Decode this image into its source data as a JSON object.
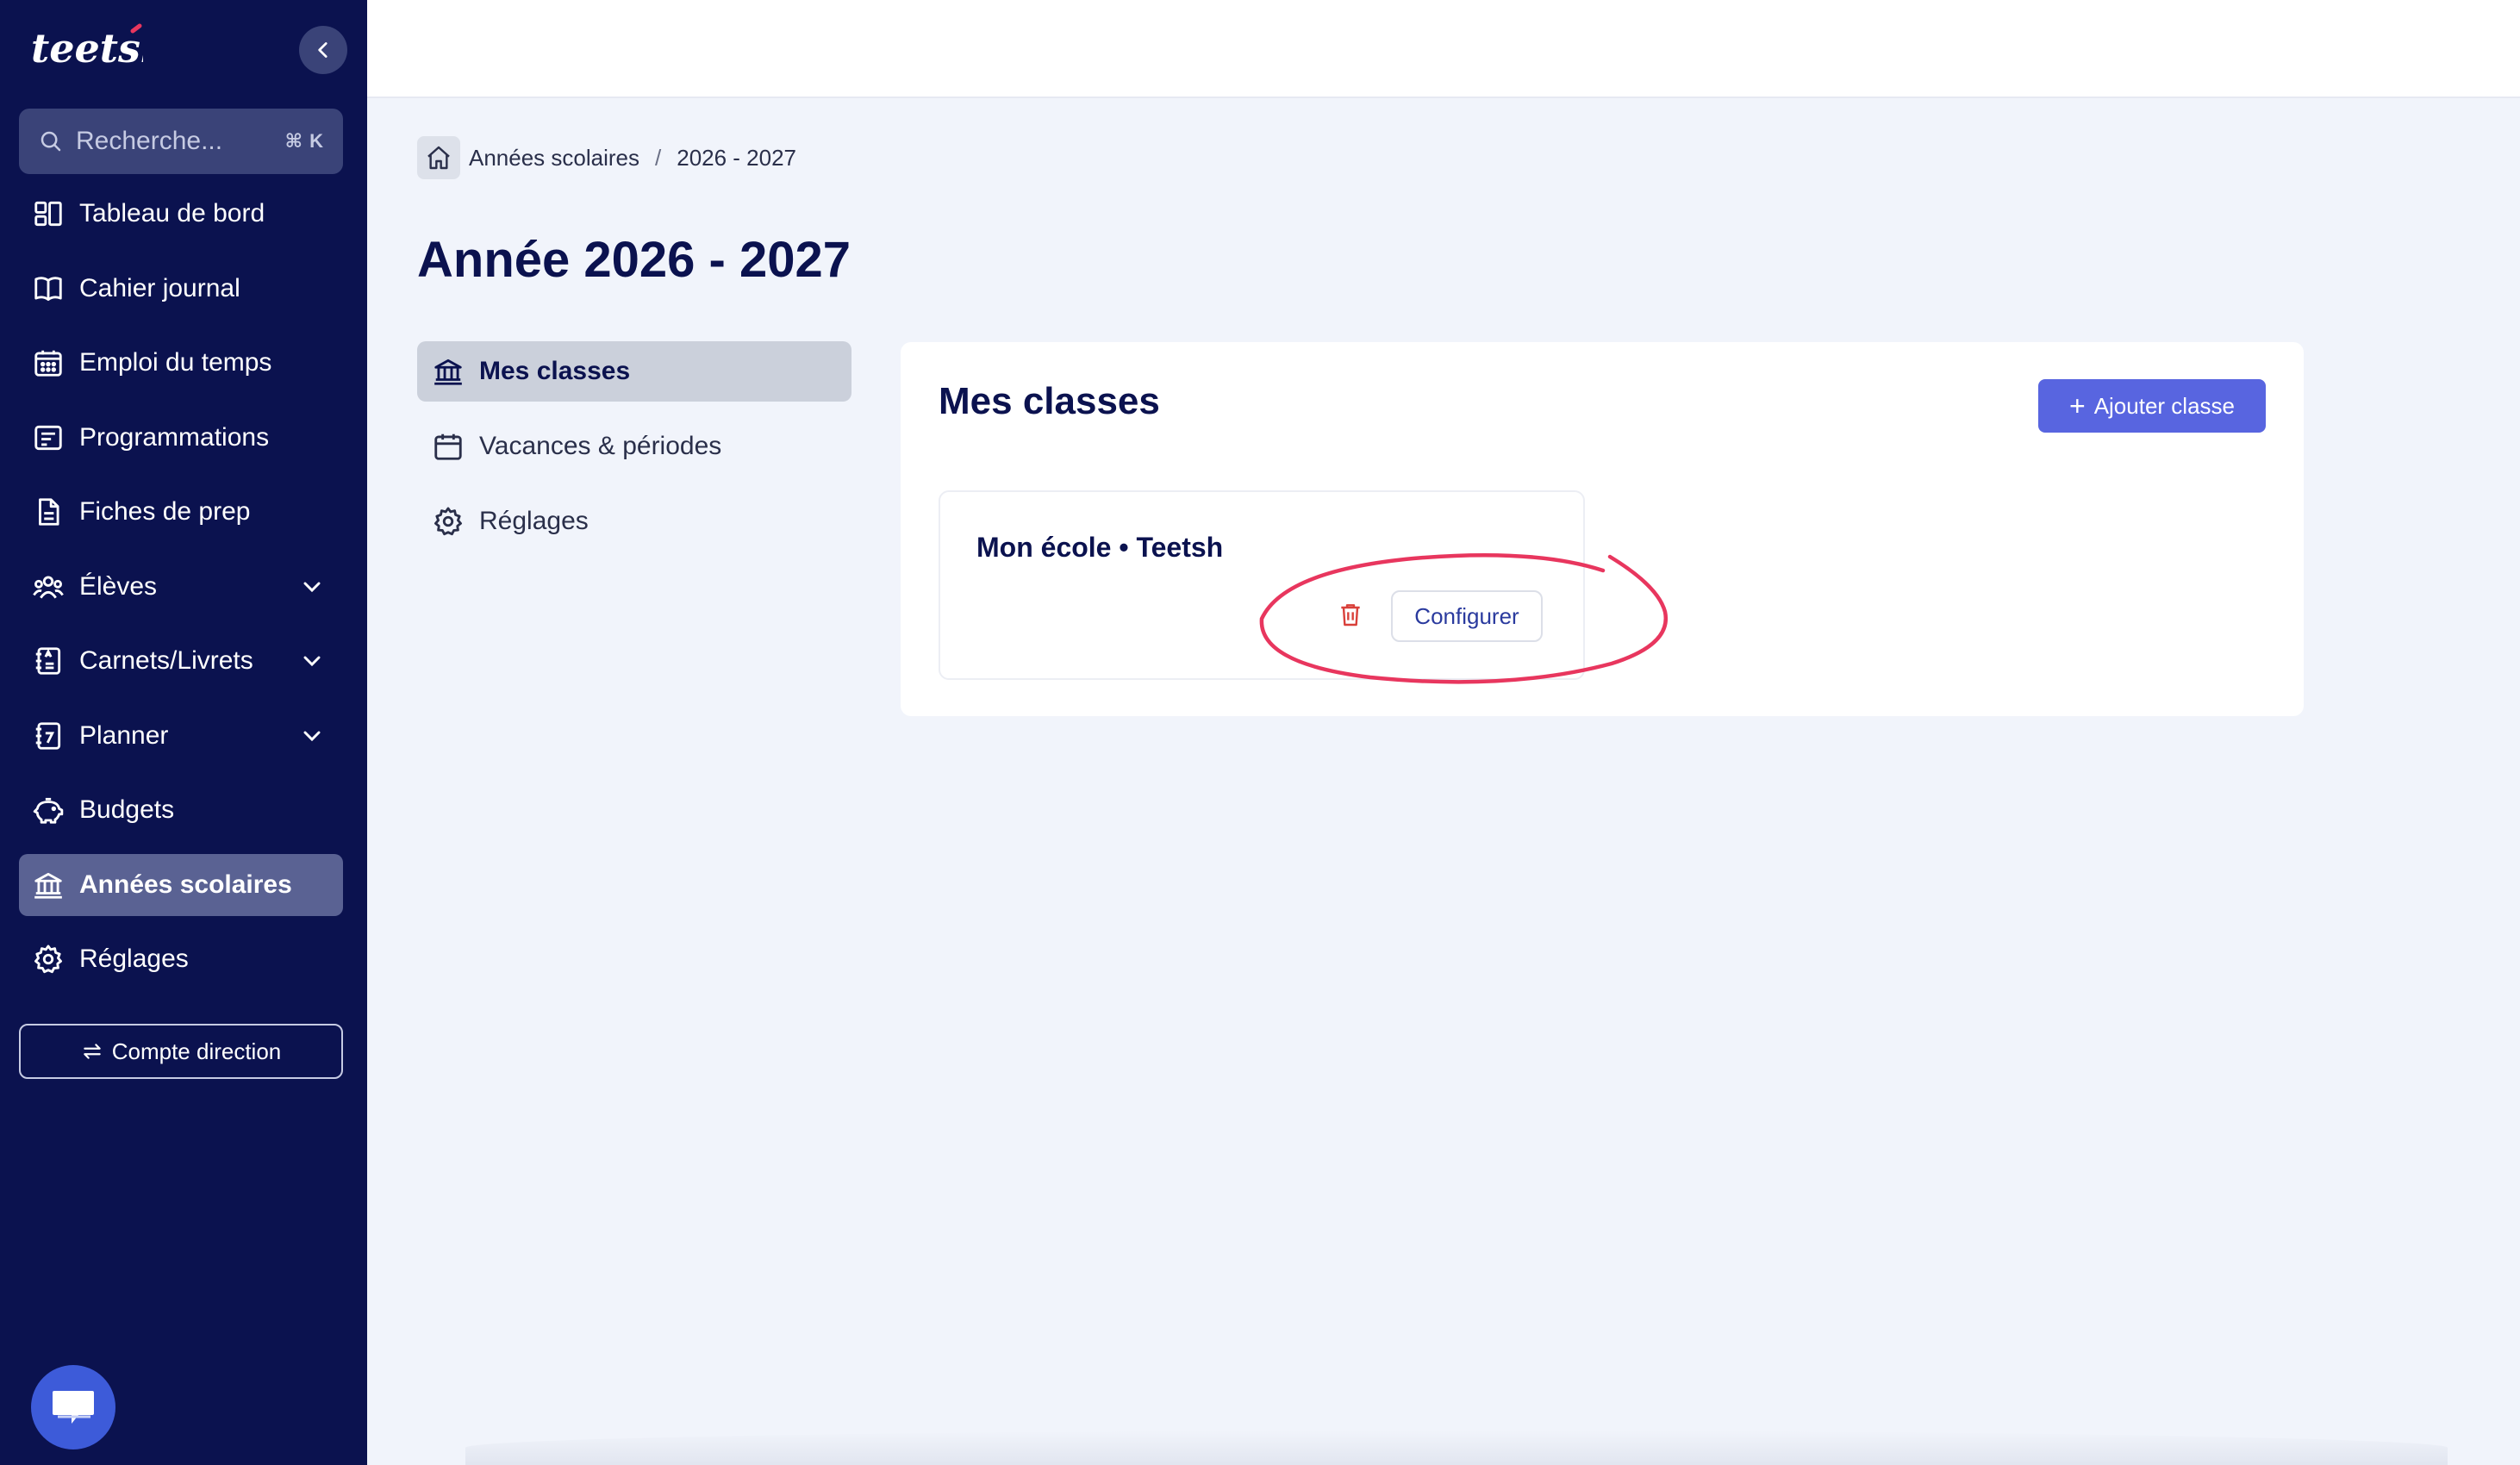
{
  "sidebar": {
    "logo_text": "teetsh",
    "search": {
      "placeholder": "Recherche...",
      "shortcut": "⌘ K"
    },
    "items": [
      {
        "label": "Tableau de bord",
        "icon": "dashboard-icon"
      },
      {
        "label": "Cahier journal",
        "icon": "book-icon"
      },
      {
        "label": "Emploi du temps",
        "icon": "calendar-grid-icon"
      },
      {
        "label": "Programmations",
        "icon": "list-board-icon"
      },
      {
        "label": "Fiches de prep",
        "icon": "document-icon"
      },
      {
        "label": "Élèves",
        "icon": "students-icon",
        "expandable": true
      },
      {
        "label": "Carnets/Livrets",
        "icon": "notebook-icon",
        "expandable": true
      },
      {
        "label": "Planner",
        "icon": "planner-icon",
        "expandable": true
      },
      {
        "label": "Budgets",
        "icon": "piggy-bank-icon"
      },
      {
        "label": "Années scolaires",
        "icon": "school-icon",
        "active": true
      },
      {
        "label": "Réglages",
        "icon": "gear-icon"
      }
    ],
    "compte_button": "Compte direction"
  },
  "breadcrumb": {
    "items": [
      "Années scolaires",
      "2026 - 2027"
    ]
  },
  "page_title": "Année 2026 - 2027",
  "subnav": {
    "items": [
      {
        "label": "Mes classes",
        "active": true
      },
      {
        "label": "Vacances & périodes"
      },
      {
        "label": "Réglages"
      }
    ]
  },
  "panel": {
    "title": "Mes classes",
    "add_button": "Ajouter classe",
    "cards": [
      {
        "title": "Mon école • Teetsh",
        "configure_label": "Configurer"
      }
    ]
  },
  "colors": {
    "sidebar_bg": "#0b124f",
    "accent": "#5865e0",
    "annotation": "#e8365e",
    "trash": "#d9403a"
  }
}
